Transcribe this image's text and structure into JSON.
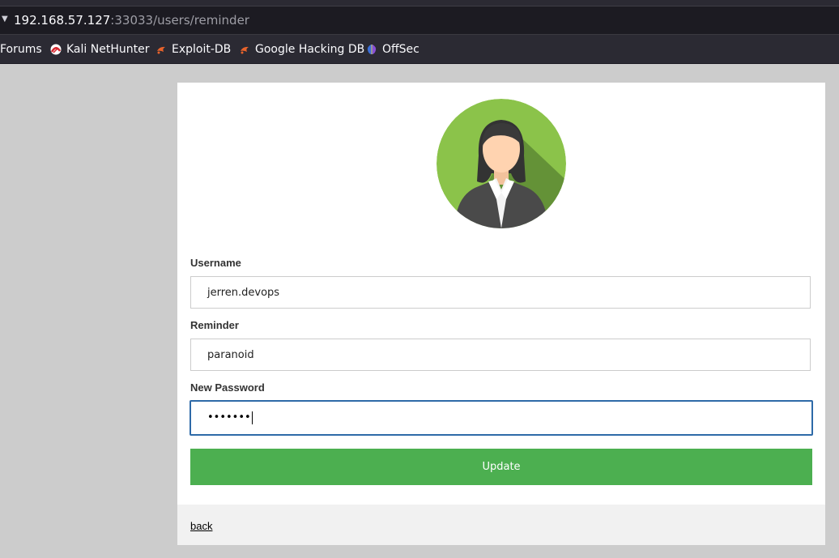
{
  "browser": {
    "url_host": "192.168.57.127",
    "url_rest": ":33033/users/reminder",
    "bookmarks": [
      {
        "label": "Forums",
        "icon": "none"
      },
      {
        "label": "Kali NetHunter",
        "icon": "kali-nethunter-icon"
      },
      {
        "label": "Exploit-DB",
        "icon": "exploit-db-icon"
      },
      {
        "label": "Google Hacking DB",
        "icon": "exploit-db-icon"
      },
      {
        "label": "OffSec",
        "icon": "offsec-icon"
      }
    ]
  },
  "form": {
    "username_label": "Username",
    "username_value": "jerren.devops",
    "reminder_label": "Reminder",
    "reminder_value": "paranoid",
    "password_label": "New Password",
    "password_value": "•••••••",
    "update_label": "Update",
    "back_label": "back"
  },
  "colors": {
    "page_bg": "#cccccc",
    "button": "#4caf50",
    "focus_border": "#2e6aa8",
    "footer_bg": "#f1f1f1"
  }
}
